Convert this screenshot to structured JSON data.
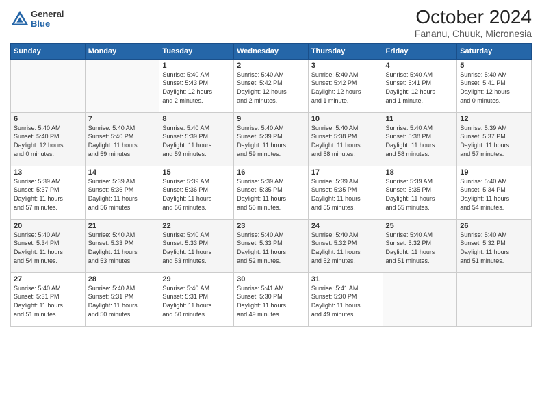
{
  "header": {
    "logo_general": "General",
    "logo_blue": "Blue",
    "title": "October 2024",
    "subtitle": "Fananu, Chuuk, Micronesia"
  },
  "days_of_week": [
    "Sunday",
    "Monday",
    "Tuesday",
    "Wednesday",
    "Thursday",
    "Friday",
    "Saturday"
  ],
  "weeks": [
    [
      {
        "day": "",
        "info": ""
      },
      {
        "day": "",
        "info": ""
      },
      {
        "day": "1",
        "info": "Sunrise: 5:40 AM\nSunset: 5:43 PM\nDaylight: 12 hours\nand 2 minutes."
      },
      {
        "day": "2",
        "info": "Sunrise: 5:40 AM\nSunset: 5:42 PM\nDaylight: 12 hours\nand 2 minutes."
      },
      {
        "day": "3",
        "info": "Sunrise: 5:40 AM\nSunset: 5:42 PM\nDaylight: 12 hours\nand 1 minute."
      },
      {
        "day": "4",
        "info": "Sunrise: 5:40 AM\nSunset: 5:41 PM\nDaylight: 12 hours\nand 1 minute."
      },
      {
        "day": "5",
        "info": "Sunrise: 5:40 AM\nSunset: 5:41 PM\nDaylight: 12 hours\nand 0 minutes."
      }
    ],
    [
      {
        "day": "6",
        "info": "Sunrise: 5:40 AM\nSunset: 5:40 PM\nDaylight: 12 hours\nand 0 minutes."
      },
      {
        "day": "7",
        "info": "Sunrise: 5:40 AM\nSunset: 5:40 PM\nDaylight: 11 hours\nand 59 minutes."
      },
      {
        "day": "8",
        "info": "Sunrise: 5:40 AM\nSunset: 5:39 PM\nDaylight: 11 hours\nand 59 minutes."
      },
      {
        "day": "9",
        "info": "Sunrise: 5:40 AM\nSunset: 5:39 PM\nDaylight: 11 hours\nand 59 minutes."
      },
      {
        "day": "10",
        "info": "Sunrise: 5:40 AM\nSunset: 5:38 PM\nDaylight: 11 hours\nand 58 minutes."
      },
      {
        "day": "11",
        "info": "Sunrise: 5:40 AM\nSunset: 5:38 PM\nDaylight: 11 hours\nand 58 minutes."
      },
      {
        "day": "12",
        "info": "Sunrise: 5:39 AM\nSunset: 5:37 PM\nDaylight: 11 hours\nand 57 minutes."
      }
    ],
    [
      {
        "day": "13",
        "info": "Sunrise: 5:39 AM\nSunset: 5:37 PM\nDaylight: 11 hours\nand 57 minutes."
      },
      {
        "day": "14",
        "info": "Sunrise: 5:39 AM\nSunset: 5:36 PM\nDaylight: 11 hours\nand 56 minutes."
      },
      {
        "day": "15",
        "info": "Sunrise: 5:39 AM\nSunset: 5:36 PM\nDaylight: 11 hours\nand 56 minutes."
      },
      {
        "day": "16",
        "info": "Sunrise: 5:39 AM\nSunset: 5:35 PM\nDaylight: 11 hours\nand 55 minutes."
      },
      {
        "day": "17",
        "info": "Sunrise: 5:39 AM\nSunset: 5:35 PM\nDaylight: 11 hours\nand 55 minutes."
      },
      {
        "day": "18",
        "info": "Sunrise: 5:39 AM\nSunset: 5:35 PM\nDaylight: 11 hours\nand 55 minutes."
      },
      {
        "day": "19",
        "info": "Sunrise: 5:40 AM\nSunset: 5:34 PM\nDaylight: 11 hours\nand 54 minutes."
      }
    ],
    [
      {
        "day": "20",
        "info": "Sunrise: 5:40 AM\nSunset: 5:34 PM\nDaylight: 11 hours\nand 54 minutes."
      },
      {
        "day": "21",
        "info": "Sunrise: 5:40 AM\nSunset: 5:33 PM\nDaylight: 11 hours\nand 53 minutes."
      },
      {
        "day": "22",
        "info": "Sunrise: 5:40 AM\nSunset: 5:33 PM\nDaylight: 11 hours\nand 53 minutes."
      },
      {
        "day": "23",
        "info": "Sunrise: 5:40 AM\nSunset: 5:33 PM\nDaylight: 11 hours\nand 52 minutes."
      },
      {
        "day": "24",
        "info": "Sunrise: 5:40 AM\nSunset: 5:32 PM\nDaylight: 11 hours\nand 52 minutes."
      },
      {
        "day": "25",
        "info": "Sunrise: 5:40 AM\nSunset: 5:32 PM\nDaylight: 11 hours\nand 51 minutes."
      },
      {
        "day": "26",
        "info": "Sunrise: 5:40 AM\nSunset: 5:32 PM\nDaylight: 11 hours\nand 51 minutes."
      }
    ],
    [
      {
        "day": "27",
        "info": "Sunrise: 5:40 AM\nSunset: 5:31 PM\nDaylight: 11 hours\nand 51 minutes."
      },
      {
        "day": "28",
        "info": "Sunrise: 5:40 AM\nSunset: 5:31 PM\nDaylight: 11 hours\nand 50 minutes."
      },
      {
        "day": "29",
        "info": "Sunrise: 5:40 AM\nSunset: 5:31 PM\nDaylight: 11 hours\nand 50 minutes."
      },
      {
        "day": "30",
        "info": "Sunrise: 5:41 AM\nSunset: 5:30 PM\nDaylight: 11 hours\nand 49 minutes."
      },
      {
        "day": "31",
        "info": "Sunrise: 5:41 AM\nSunset: 5:30 PM\nDaylight: 11 hours\nand 49 minutes."
      },
      {
        "day": "",
        "info": ""
      },
      {
        "day": "",
        "info": ""
      }
    ]
  ]
}
